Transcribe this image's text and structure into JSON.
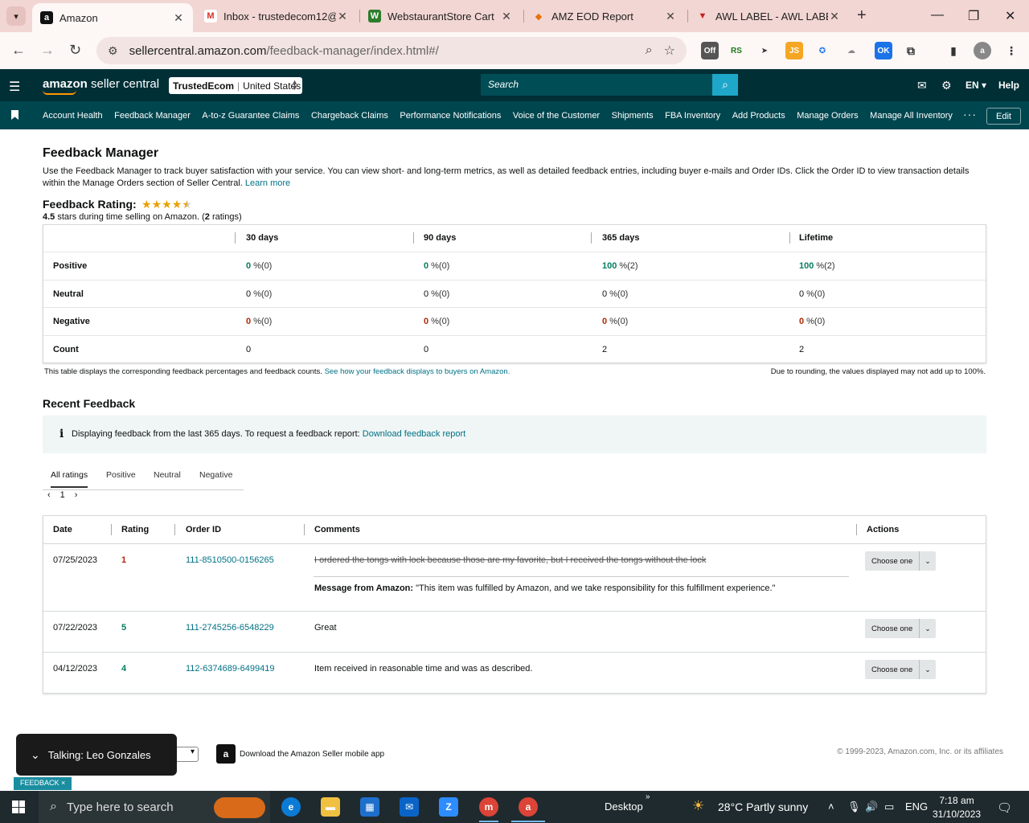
{
  "browser": {
    "tabs": [
      {
        "title": "Amazon",
        "favicon": "a",
        "color": "#111111"
      },
      {
        "title": "Inbox - trustedecom12@",
        "favicon": "M",
        "color": "#d93025"
      },
      {
        "title": "WebstaurantStore Cart",
        "favicon": "W",
        "color": "#2d7d2d"
      },
      {
        "title": "AMZ EOD Report",
        "favicon": "◆",
        "color": "#e8710a"
      },
      {
        "title": "AWL LABEL - AWL LABEL",
        "favicon": "▼",
        "color": "#c5221f"
      }
    ],
    "url_host": "sellercentral.amazon.com",
    "url_path": "/feedback-manager/index.html#/",
    "profile_initial": "a"
  },
  "amazon": {
    "logo_brand": "amazon",
    "logo_rest": " seller central",
    "account_name": "TrustedEcom",
    "account_region": "United States",
    "search_placeholder": "Search",
    "lang": "EN ▾",
    "help": "Help",
    "nav": [
      "Account Health",
      "Feedback Manager",
      "A-to-z Guarantee Claims",
      "Chargeback Claims",
      "Performance Notifications",
      "Voice of the Customer",
      "Shipments",
      "FBA Inventory",
      "Add Products",
      "Manage Orders",
      "Manage All Inventory"
    ],
    "edit": "Edit"
  },
  "page": {
    "title": "Feedback Manager",
    "intro": "Use the Feedback Manager to track buyer satisfaction with your service. You can view short- and long-term metrics, as well as detailed feedback entries, including buyer e-mails and Order IDs. Click the Order ID to view transaction details within the Manage Orders section of Seller Central.",
    "learn_more": "Learn more",
    "rating_heading": "Feedback Rating:",
    "rating_stars": 4.5,
    "rating_value": "4.5",
    "rating_sub": " stars during time selling on Amazon. (",
    "rating_count": "2",
    "rating_sub2": " ratings)",
    "table": {
      "headers": [
        "30 days",
        "90 days",
        "365 days",
        "Lifetime"
      ],
      "rows": [
        {
          "label": "Positive",
          "cells": [
            {
              "v": "0",
              "p": "%(0)",
              "cls": "green"
            },
            {
              "v": "0",
              "p": "%(0)",
              "cls": "green"
            },
            {
              "v": "100",
              "p": "%(2)",
              "cls": "green"
            },
            {
              "v": "100",
              "p": "%(2)",
              "cls": "green"
            }
          ]
        },
        {
          "label": "Neutral",
          "cells": [
            {
              "v": "0",
              "p": "%(0)",
              "cls": ""
            },
            {
              "v": "0",
              "p": "%(0)",
              "cls": ""
            },
            {
              "v": "0",
              "p": "%(0)",
              "cls": ""
            },
            {
              "v": "0",
              "p": "%(0)",
              "cls": ""
            }
          ]
        },
        {
          "label": "Negative",
          "cells": [
            {
              "v": "0",
              "p": "%(0)",
              "cls": "red"
            },
            {
              "v": "0",
              "p": "%(0)",
              "cls": "red"
            },
            {
              "v": "0",
              "p": "%(0)",
              "cls": "red"
            },
            {
              "v": "0",
              "p": "%(0)",
              "cls": "red"
            }
          ]
        },
        {
          "label": "Count",
          "cells": [
            {
              "v": "0",
              "p": "",
              "cls": ""
            },
            {
              "v": "0",
              "p": "",
              "cls": ""
            },
            {
              "v": "2",
              "p": "",
              "cls": ""
            },
            {
              "v": "2",
              "p": "",
              "cls": ""
            }
          ]
        }
      ],
      "note_left": "This table displays the corresponding feedback percentages and feedback counts.",
      "note_left_link": "See how your feedback displays to buyers on Amazon.",
      "note_right": "Due to rounding, the values displayed may not add up to 100%."
    },
    "recent_heading": "Recent Feedback",
    "info_text": "Displaying feedback from the last 365 days. To request a feedback report:",
    "info_link": "Download feedback report",
    "filter_tabs": [
      "All ratings",
      "Positive",
      "Neutral",
      "Negative"
    ],
    "page_number": "1",
    "feedback_headers": [
      "Date",
      "Rating",
      "Order ID",
      "Comments",
      "Actions"
    ],
    "feedback": [
      {
        "date": "07/25/2023",
        "rating": "1",
        "order": "111-8510500-0156265",
        "comment": "I ordered the tongs with lock because those are my favorite, but I received the tongs without the lock",
        "struck": true,
        "msg_label": "Message from Amazon:",
        "msg": " \"This item was fulfilled by Amazon, and we take responsibility for this fulfillment experience.\"",
        "action": "Choose one"
      },
      {
        "date": "07/22/2023",
        "rating": "5",
        "order": "111-2745256-6548229",
        "comment": "Great",
        "struck": false,
        "action": "Choose one"
      },
      {
        "date": "04/12/2023",
        "rating": "4",
        "order": "112-6374689-6499419",
        "comment": "Item received in reasonable time and was as described.",
        "struck": false,
        "action": "Choose one"
      }
    ]
  },
  "footer": {
    "app_text": "Download the Amazon Seller mobile app",
    "copyright": "© 1999-2023, Amazon.com, Inc. or its affiliates",
    "talking": "Talking: Leo Gonzales",
    "feedback_badge": "FEEDBACK ×"
  },
  "taskbar": {
    "search_placeholder": "Type here to search",
    "desktop": "Desktop",
    "weather": "28°C  Partly sunny",
    "lang": "ENG",
    "time": "7:18 am",
    "date": "31/10/2023"
  }
}
